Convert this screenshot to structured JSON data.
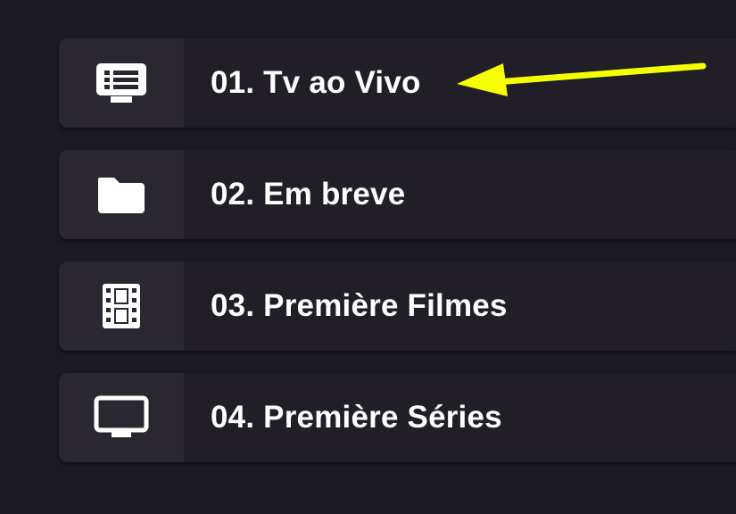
{
  "menu": {
    "items": [
      {
        "label": "01. Tv ao Vivo",
        "icon": "live-tv-icon"
      },
      {
        "label": "02. Em breve",
        "icon": "folder-icon"
      },
      {
        "label": "03. Première Filmes",
        "icon": "film-strip-icon"
      },
      {
        "label": "04. Première Séries",
        "icon": "monitor-icon"
      }
    ]
  },
  "annotation": {
    "arrow_color": "#f5ff00",
    "points_to": "01. Tv ao Vivo"
  },
  "colors": {
    "background": "#1c1a22",
    "item_background": "#211e28",
    "icon_box_background": "#2a2731",
    "text": "#ffffff"
  }
}
